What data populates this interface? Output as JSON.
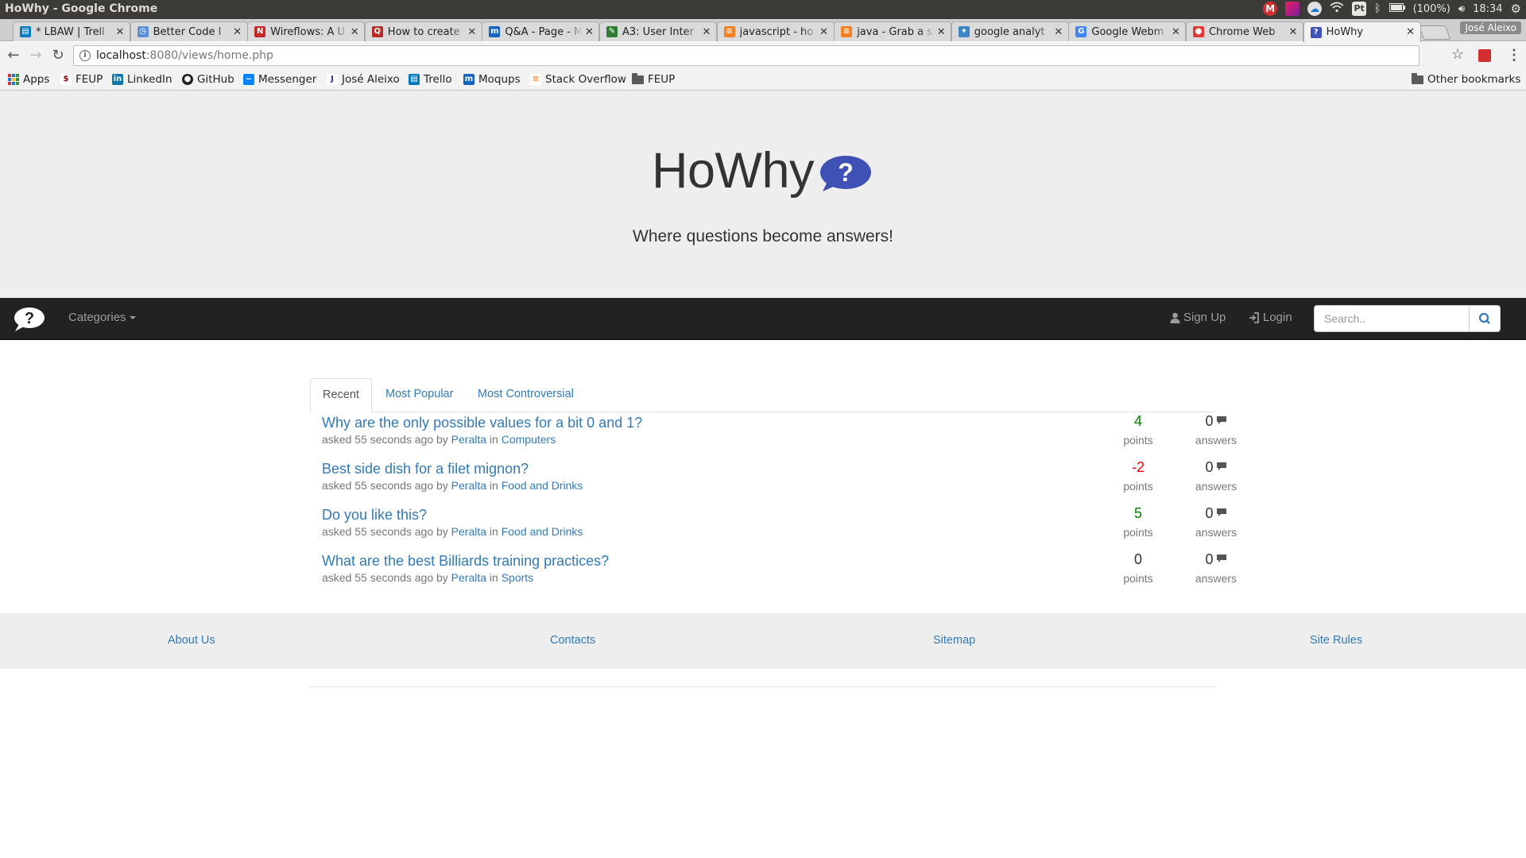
{
  "os": {
    "window_title": "HoWhy - Google Chrome",
    "battery": "(100%)",
    "clock": "18:34",
    "keyboard_layout": "Pt"
  },
  "browser": {
    "tabs": [
      {
        "label": "* LBAW | Trell",
        "favicon": "trello-icon",
        "color": "#0079bf"
      },
      {
        "label": "Better Code I",
        "favicon": "clock-icon",
        "color": "#5b8fd6"
      },
      {
        "label": "Wireflows: A U",
        "favicon": "nn-icon",
        "color": "#c62828"
      },
      {
        "label": "How to create",
        "favicon": "quora-icon",
        "color": "#b92b27"
      },
      {
        "label": "Q&A - Page - M",
        "favicon": "moqups-icon",
        "color": "#1565c0"
      },
      {
        "label": "A3: User Inter",
        "favicon": "pencil-icon",
        "color": "#2e7d32"
      },
      {
        "label": "javascript - ho",
        "favicon": "stackoverflow-icon",
        "color": "#f48024"
      },
      {
        "label": "java - Grab a s",
        "favicon": "stackoverflow-icon",
        "color": "#f48024"
      },
      {
        "label": "google analyt",
        "favicon": "stackexchange-icon",
        "color": "#3d86c6"
      },
      {
        "label": "Google Webm",
        "favicon": "google-icon",
        "color": "#4285f4"
      },
      {
        "label": "Chrome Web",
        "favicon": "chrome-icon",
        "color": "#e53935"
      },
      {
        "label": "HoWhy",
        "favicon": "howhy-icon",
        "color": "#3f51b5",
        "active": true
      }
    ],
    "profile_name": "José Aleixo",
    "address": {
      "host": "localhost",
      "path": ":8080/views/home.php"
    },
    "bookmarks": [
      {
        "label": "Apps",
        "icon": "apps-grid-icon"
      },
      {
        "label": "FEUP",
        "icon": "feup-icon"
      },
      {
        "label": "LinkedIn",
        "icon": "linkedin-icon"
      },
      {
        "label": "GitHub",
        "icon": "github-icon"
      },
      {
        "label": "Messenger",
        "icon": "messenger-icon"
      },
      {
        "label": "José Aleixo",
        "icon": "j-icon"
      },
      {
        "label": "Trello",
        "icon": "trello-icon"
      },
      {
        "label": "Moqups",
        "icon": "moqups-icon"
      },
      {
        "label": "Stack Overflow",
        "icon": "stackoverflow-icon"
      },
      {
        "label": "FEUP",
        "icon": "folder-icon"
      }
    ],
    "other_bookmarks": "Other bookmarks"
  },
  "site": {
    "title": "HoWhy",
    "tagline": "Where questions become answers!",
    "nav": {
      "categories": "Categories",
      "signup": "Sign Up",
      "login": "Login",
      "search_placeholder": "Search.."
    },
    "tabs": [
      "Recent",
      "Most Popular",
      "Most Controversial"
    ],
    "questions": [
      {
        "title": "Why are the only possible values for a bit 0 and 1?",
        "asked": "asked 55 seconds ago by",
        "author": "Peralta",
        "in": "in",
        "category": "Computers",
        "points": "4",
        "points_label": "points",
        "answers": "0",
        "answers_label": "answers",
        "points_color": "#008000"
      },
      {
        "title": "Best side dish for a filet mignon?",
        "asked": "asked 55 seconds ago by",
        "author": "Peralta",
        "in": "in",
        "category": "Food and Drinks",
        "points": "-2",
        "points_label": "points",
        "answers": "0",
        "answers_label": "answers",
        "points_color": "#ff0000"
      },
      {
        "title": "Do you like this?",
        "asked": "asked 55 seconds ago by",
        "author": "Peralta",
        "in": "in",
        "category": "Food and Drinks",
        "points": "5",
        "points_label": "points",
        "answers": "0",
        "answers_label": "answers",
        "points_color": "#008000"
      },
      {
        "title": "What are the best Billiards training practices?",
        "asked": "asked 55 seconds ago by",
        "author": "Peralta",
        "in": "in",
        "category": "Sports",
        "points": "0",
        "points_label": "points",
        "answers": "0",
        "answers_label": "answers",
        "points_color": "#333333"
      }
    ],
    "footer": [
      "About Us",
      "Contacts",
      "Sitemap",
      "Site Rules"
    ]
  },
  "colors": {
    "link": "#337ab7",
    "navbar": "#222222",
    "hero_bg": "#eeeeee",
    "logo_blue": "#3f51b5"
  }
}
